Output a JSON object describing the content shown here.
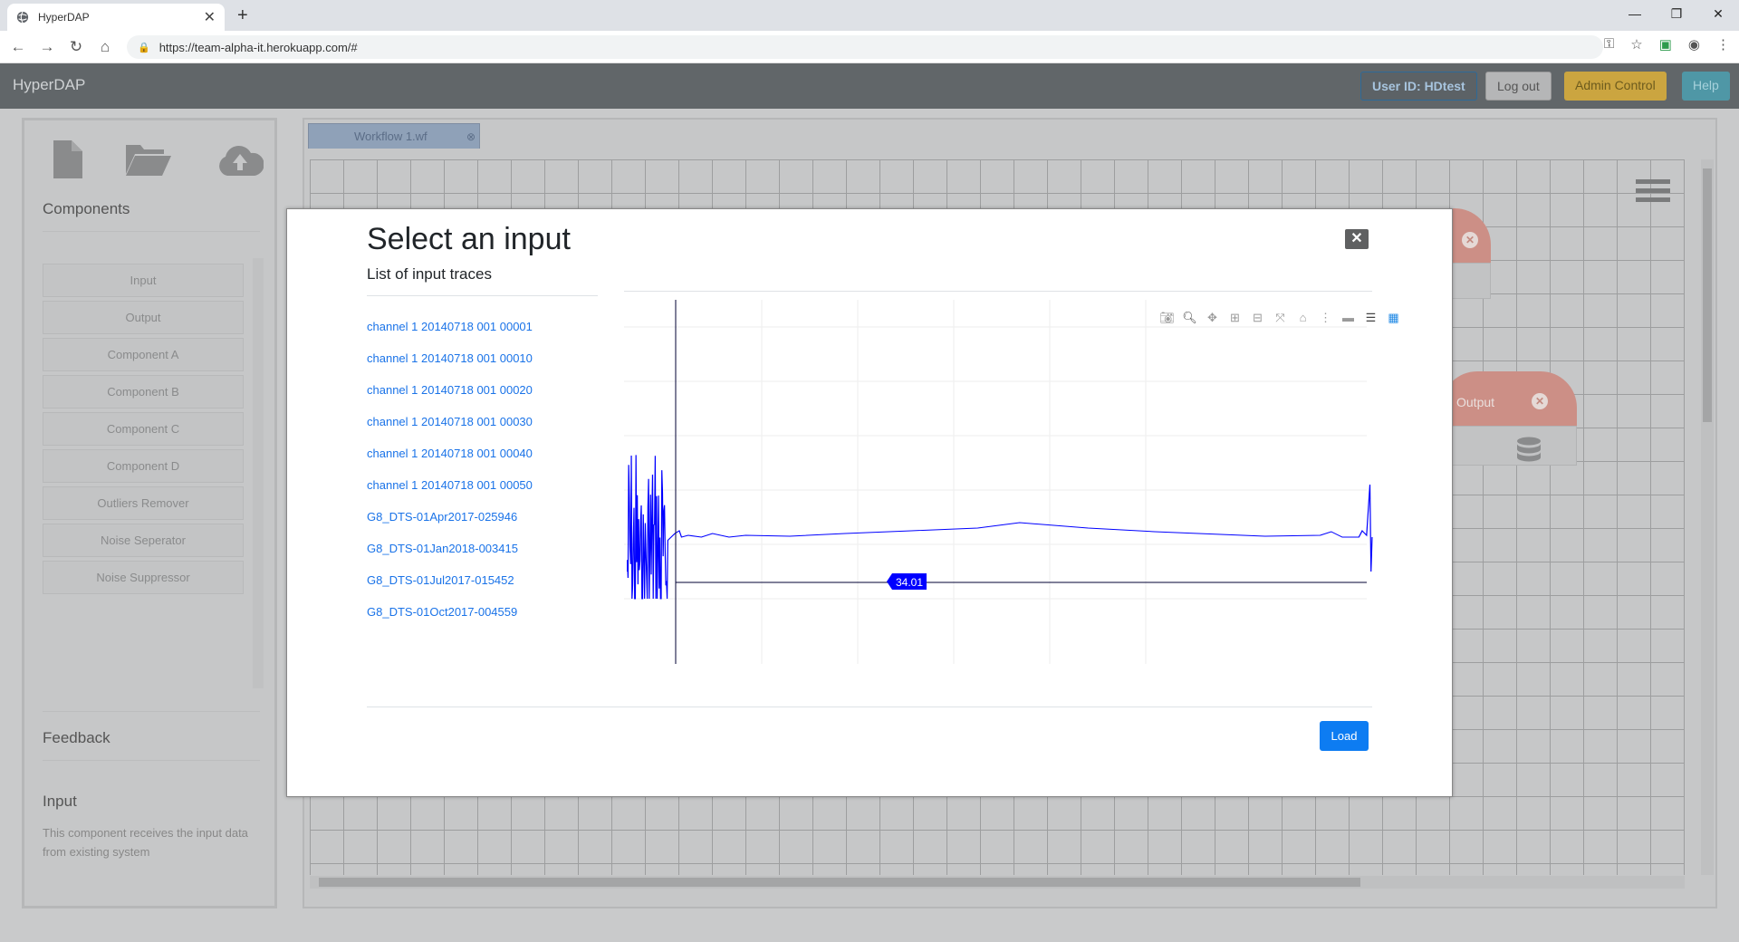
{
  "browser": {
    "tab_title": "HyperDAP",
    "url": "https://team-alpha-it.herokuapp.com/#"
  },
  "app": {
    "brand": "HyperDAP",
    "user_id": "User ID: HDtest",
    "logout": "Log out",
    "admin": "Admin Control",
    "help": "Help"
  },
  "sidebar": {
    "components_heading": "Components",
    "components": [
      "Input",
      "Output",
      "Component A",
      "Component B",
      "Component C",
      "Component D",
      "Outliers Remover",
      "Noise Seperator",
      "Noise Suppressor"
    ],
    "feedback_heading": "Feedback",
    "selected_title": "Input",
    "selected_desc": "This component receives the input data from existing system"
  },
  "workspace": {
    "tab": "Workflow 1.wf",
    "output_node_label": "Output"
  },
  "modal": {
    "title": "Select an input",
    "subtitle": "List of input traces",
    "traces": [
      "channel 1 20140718 001 00001",
      "channel 1 20140718 001 00010",
      "channel 1 20140718 001 00020",
      "channel 1 20140718 001 00030",
      "channel 1 20140718 001 00040",
      "channel 1 20140718 001 00050",
      "G8_DTS-01Apr2017-025946",
      "G8_DTS-01Jan2018-003415",
      "G8_DTS-01Jul2017-015452",
      "G8_DTS-01Oct2017-004559"
    ],
    "load": "Load",
    "hover_label": "34.01"
  },
  "colors": {
    "trace": "#0000ff",
    "primary": "#0d7cf2"
  }
}
